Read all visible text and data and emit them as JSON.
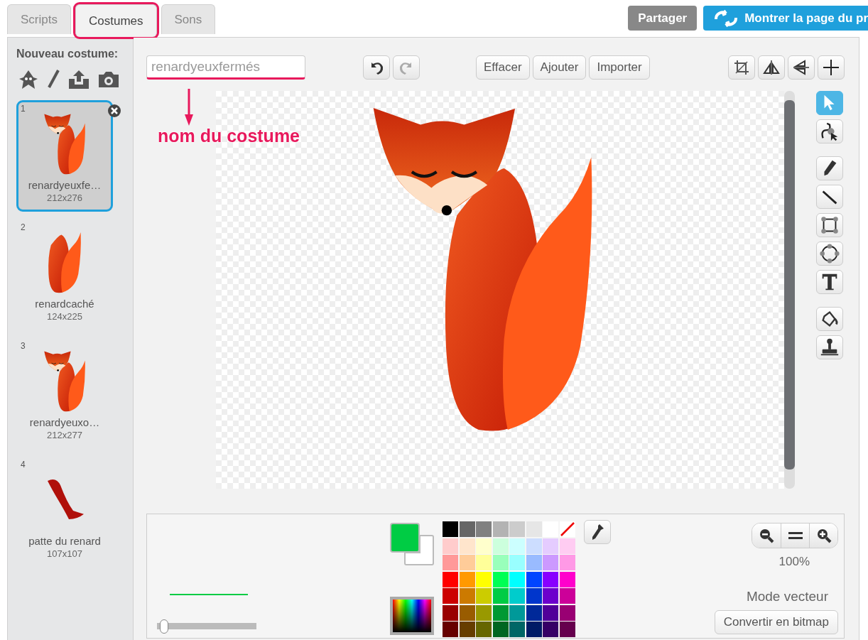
{
  "tabs": [
    {
      "label": "Scripts",
      "selected": false
    },
    {
      "label": "Costumes",
      "selected": true
    },
    {
      "label": "Sons",
      "selected": false
    }
  ],
  "top_buttons": {
    "share": "Partager",
    "project_page": "Montrer la page du pr"
  },
  "sidebar": {
    "title": "Nouveau costume:"
  },
  "costumes": [
    {
      "number": "1",
      "name": "renardyeuxfe…",
      "size": "212x276",
      "kind": "fox",
      "selected": true
    },
    {
      "number": "2",
      "name": "renardcaché",
      "size": "124x225",
      "kind": "tail",
      "selected": false
    },
    {
      "number": "3",
      "name": "renardyeuxo…",
      "size": "212x277",
      "kind": "fox",
      "selected": false
    },
    {
      "number": "4",
      "name": "patte du renard",
      "size": "107x107",
      "kind": "paw",
      "selected": false
    }
  ],
  "editor": {
    "costume_name": "renardyeuxfermés",
    "buttons": [
      "Effacer",
      "Ajouter",
      "Importer"
    ]
  },
  "annotation": {
    "label": "nom du costume"
  },
  "tools": [
    {
      "kind": "select",
      "selected": true
    },
    {
      "kind": "reshape",
      "selected": false
    },
    {
      "kind": "pencil",
      "selected": false
    },
    {
      "kind": "line",
      "selected": false
    },
    {
      "kind": "rectangle",
      "selected": false
    },
    {
      "kind": "ellipse",
      "selected": false
    },
    {
      "kind": "text",
      "selected": false
    },
    {
      "kind": "fill",
      "selected": false
    },
    {
      "kind": "stamp",
      "selected": false
    }
  ],
  "fill_colors": [
    {
      "color": "#00cc44"
    },
    {
      "color": "#ffffff"
    }
  ],
  "stroke_width": {
    "level": 0.03
  },
  "palette": [
    {
      "kind": "swatch",
      "color": "#000000"
    },
    {
      "kind": "swatch",
      "color": "#666666"
    },
    {
      "kind": "swatch",
      "color": "#808080"
    },
    {
      "kind": "swatch",
      "color": "#b3b3b3"
    },
    {
      "kind": "swatch",
      "color": "#cccccc"
    },
    {
      "kind": "swatch",
      "color": "#e6e6e6"
    },
    {
      "kind": "swatch",
      "color": "#ffffff"
    },
    {
      "kind": "none"
    },
    {
      "kind": "swatch",
      "color": "#ffcccc"
    },
    {
      "kind": "swatch",
      "color": "#ffe5cc"
    },
    {
      "kind": "swatch",
      "color": "#ffffcc"
    },
    {
      "kind": "swatch",
      "color": "#ccffdd"
    },
    {
      "kind": "swatch",
      "color": "#ccffff"
    },
    {
      "kind": "swatch",
      "color": "#ccddff"
    },
    {
      "kind": "swatch",
      "color": "#e5ccff"
    },
    {
      "kind": "swatch",
      "color": "#ffccf2"
    },
    {
      "kind": "swatch",
      "color": "#ff9999"
    },
    {
      "kind": "swatch",
      "color": "#ffcc99"
    },
    {
      "kind": "swatch",
      "color": "#ffff99"
    },
    {
      "kind": "swatch",
      "color": "#99ffbb"
    },
    {
      "kind": "swatch",
      "color": "#99ffff"
    },
    {
      "kind": "swatch",
      "color": "#99bbff"
    },
    {
      "kind": "swatch",
      "color": "#cc99ff"
    },
    {
      "kind": "swatch",
      "color": "#ff99e6"
    },
    {
      "kind": "swatch",
      "color": "#ff0000"
    },
    {
      "kind": "swatch",
      "color": "#ff9900"
    },
    {
      "kind": "swatch",
      "color": "#ffff00"
    },
    {
      "kind": "swatch",
      "color": "#00ff55"
    },
    {
      "kind": "swatch",
      "color": "#00ffff"
    },
    {
      "kind": "swatch",
      "color": "#0044ff"
    },
    {
      "kind": "swatch",
      "color": "#8800ff"
    },
    {
      "kind": "swatch",
      "color": "#ff00cc"
    },
    {
      "kind": "swatch",
      "color": "#cc0000"
    },
    {
      "kind": "swatch",
      "color": "#cc7a00"
    },
    {
      "kind": "swatch",
      "color": "#cccc00"
    },
    {
      "kind": "swatch",
      "color": "#00cc44"
    },
    {
      "kind": "swatch",
      "color": "#00cccc"
    },
    {
      "kind": "swatch",
      "color": "#0036cc"
    },
    {
      "kind": "swatch",
      "color": "#6c00cc"
    },
    {
      "kind": "swatch",
      "color": "#cc0099"
    },
    {
      "kind": "swatch",
      "color": "#990000"
    },
    {
      "kind": "swatch",
      "color": "#995c00"
    },
    {
      "kind": "swatch",
      "color": "#999900"
    },
    {
      "kind": "swatch",
      "color": "#009933"
    },
    {
      "kind": "swatch",
      "color": "#009999"
    },
    {
      "kind": "swatch",
      "color": "#002999"
    },
    {
      "kind": "swatch",
      "color": "#510099"
    },
    {
      "kind": "swatch",
      "color": "#990073"
    },
    {
      "kind": "swatch",
      "color": "#660000"
    },
    {
      "kind": "swatch",
      "color": "#663d00"
    },
    {
      "kind": "swatch",
      "color": "#666600"
    },
    {
      "kind": "swatch",
      "color": "#006622"
    },
    {
      "kind": "swatch",
      "color": "#006666"
    },
    {
      "kind": "swatch",
      "color": "#001b66"
    },
    {
      "kind": "swatch",
      "color": "#360066"
    },
    {
      "kind": "swatch",
      "color": "#66004d"
    }
  ],
  "zoom": {
    "level_text": "100%"
  },
  "mode": {
    "label": "Mode vecteur",
    "convert_button": "Convertir en bitmap"
  }
}
